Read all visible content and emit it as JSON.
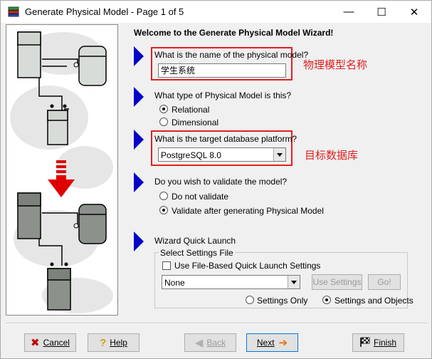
{
  "window": {
    "title": "Generate Physical Model - Page 1 of 5",
    "minimize": "—",
    "maximize": "☐",
    "close": "✕"
  },
  "wizard": {
    "heading": "Welcome to the Generate Physical Model Wizard!",
    "q_name": "What is the name of the physical model?",
    "name_value": "学生系统",
    "q_type": "What type of Physical Model is this?",
    "type_options": [
      "Relational",
      "Dimensional"
    ],
    "type_selected": "Relational",
    "q_platform": "What is the target database platform?",
    "platform_value": "PostgreSQL 8.0",
    "q_validate": "Do you wish to validate the model?",
    "validate_options": [
      "Do not validate",
      "Validate after generating Physical Model"
    ],
    "validate_selected": "Validate after generating Physical Model",
    "quick_launch": "Wizard Quick Launch",
    "settings_group": "Select Settings File",
    "use_file_based": "Use File-Based Quick Launch Settings",
    "settings_value": "None",
    "use_settings_btn": "Use Settings",
    "go_btn": "Go!",
    "settings_only": "Settings Only",
    "settings_and_objects": "Settings and Objects",
    "settings_scope_selected": "Settings and Objects"
  },
  "annotations": {
    "name_note": "物理模型名称",
    "platform_note": "目标数据库"
  },
  "buttons": {
    "cancel": "Cancel",
    "help": "Help",
    "back": "Back",
    "next": "Next",
    "finish": "Finish"
  },
  "colors": {
    "annotation_red": "#e02020",
    "arrow_blue": "#0000c8",
    "diagram_arrow_red": "#e00000"
  }
}
